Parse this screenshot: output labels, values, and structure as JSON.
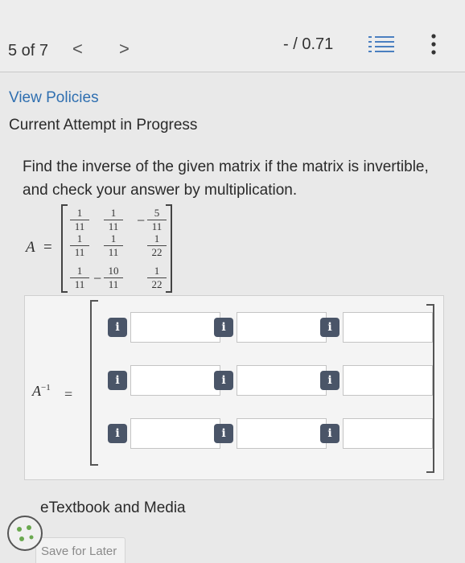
{
  "header": {
    "counter": "5 of 7",
    "prev_glyph": "<",
    "next_glyph": ">",
    "score": "- / 0.71"
  },
  "links": {
    "view_policies": "View Policies"
  },
  "status": {
    "attempt": "Current Attempt in Progress"
  },
  "question": {
    "text": "Find the inverse of the given matrix if the matrix is invertible, and check your answer by multiplication.",
    "matrix_label": "A",
    "equals": "=",
    "matrix": [
      [
        {
          "sign": "",
          "num": "1",
          "den": "11"
        },
        {
          "sign": "",
          "num": "1",
          "den": "11"
        },
        {
          "sign": "−",
          "num": "5",
          "den": "11"
        }
      ],
      [
        {
          "sign": "",
          "num": "1",
          "den": "11"
        },
        {
          "sign": "",
          "num": "1",
          "den": "11"
        },
        {
          "sign": "",
          "num": "1",
          "den": "22"
        }
      ],
      [
        {
          "sign": "",
          "num": "1",
          "den": "11"
        },
        {
          "sign": "−",
          "num": "10",
          "den": "11"
        },
        {
          "sign": "",
          "num": "1",
          "den": "22"
        }
      ]
    ]
  },
  "answer": {
    "label": "A",
    "superscript": "−1",
    "equals": "=",
    "info_glyph": "i",
    "rows": 3,
    "cols": 3
  },
  "footer": {
    "etextbook": "eTextbook and Media",
    "save_label": "Save for Later"
  },
  "colors": {
    "link": "#2f6fb0",
    "info_badge": "#4a5568"
  }
}
